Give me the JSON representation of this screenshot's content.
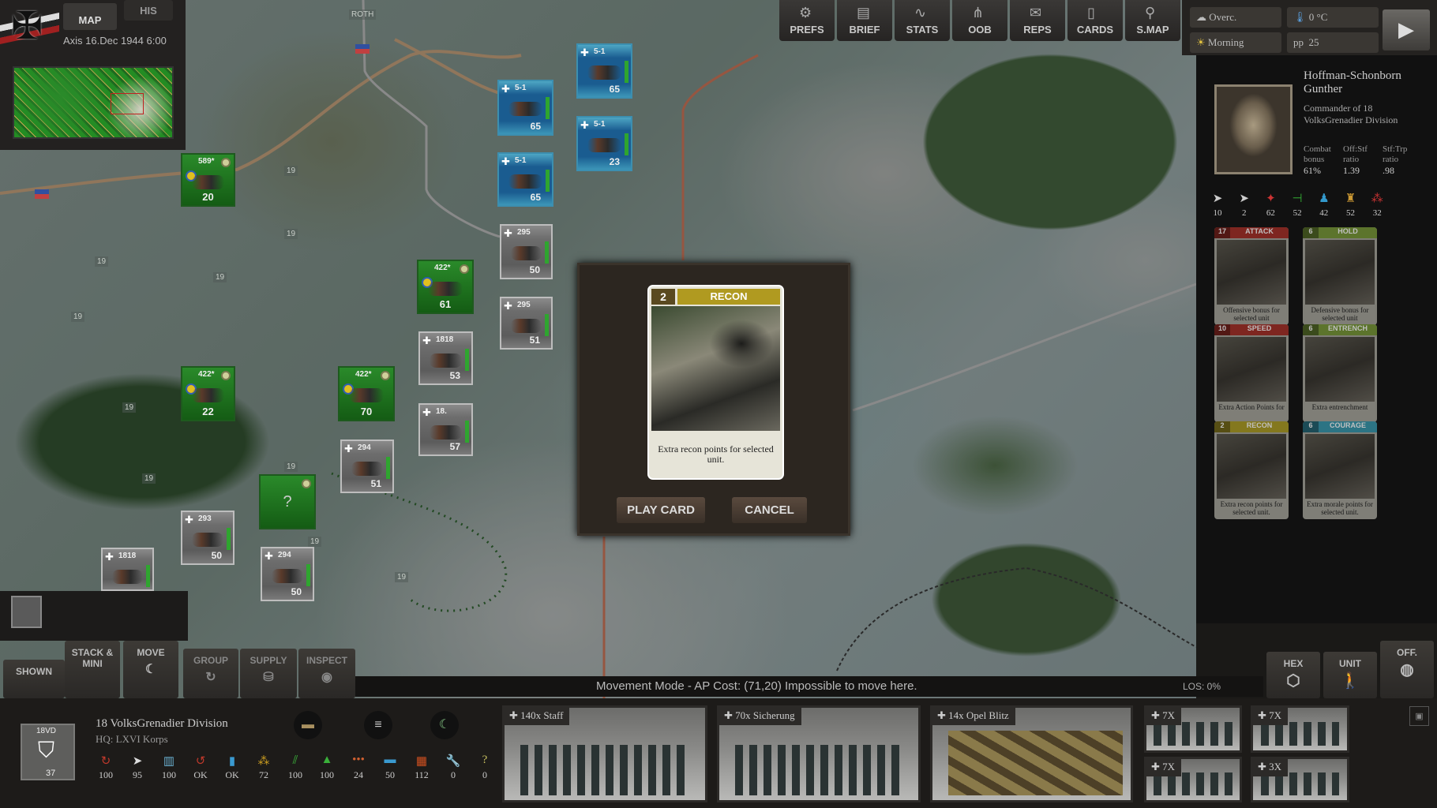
{
  "header": {
    "tabs": [
      {
        "label": "MAP"
      },
      {
        "label": "HIS"
      }
    ],
    "date": "Axis 16.Dec 1944 6:00"
  },
  "map": {
    "town_label": "ROTH",
    "hex_label": "19",
    "units": [
      {
        "side": "green",
        "label": "589*",
        "value": "20"
      },
      {
        "side": "green",
        "label": "422*",
        "value": "61"
      },
      {
        "side": "green",
        "label": "422*",
        "value": "22"
      },
      {
        "side": "green",
        "label": "422*",
        "value": "70"
      },
      {
        "side": "green",
        "label": "",
        "value": "?"
      },
      {
        "side": "blue",
        "label": "5-1",
        "value": "65"
      },
      {
        "side": "blue",
        "label": "5-1",
        "value": "65"
      },
      {
        "side": "blue",
        "label": "5-1",
        "value": "23"
      },
      {
        "side": "blue",
        "label": "5-1",
        "value": "65"
      },
      {
        "side": "gray",
        "label": "295",
        "value": "50"
      },
      {
        "side": "gray",
        "label": "295",
        "value": "51"
      },
      {
        "side": "gray",
        "label": "1818",
        "value": "53"
      },
      {
        "side": "gray",
        "label": "18.",
        "value": "57"
      },
      {
        "side": "gray",
        "label": "294",
        "value": "51"
      },
      {
        "side": "gray",
        "label": "293",
        "value": "50"
      },
      {
        "side": "gray",
        "label": "1818",
        "value": ""
      },
      {
        "side": "gray",
        "label": "294",
        "value": "50"
      }
    ]
  },
  "toolbar": [
    {
      "label": "PREFS",
      "icon": "gear-icon",
      "glyph": "⚙"
    },
    {
      "label": "BRIEF",
      "icon": "document-icon",
      "glyph": "▤"
    },
    {
      "label": "STATS",
      "icon": "chart-icon",
      "glyph": "∿"
    },
    {
      "label": "OOB",
      "icon": "hierarchy-icon",
      "glyph": "⋔"
    },
    {
      "label": "REPS",
      "icon": "report-icon",
      "glyph": "✉"
    },
    {
      "label": "CARDS",
      "icon": "cards-icon",
      "glyph": "▯"
    },
    {
      "label": "S.MAP",
      "icon": "map-pin-icon",
      "glyph": "⚲"
    }
  ],
  "weather": {
    "sky": "Overc.",
    "temperature": "0 °C",
    "time_of_day": "Morning",
    "pp_label": "pp",
    "pp": "25"
  },
  "commander": {
    "name": "Hoffman-Schonborn Gunther",
    "title": "Commander of 18 VolksGrenadier Division",
    "stats": [
      {
        "label": "Combat bonus",
        "value": "61%"
      },
      {
        "label": "Off:Stf ratio",
        "value": "1.39"
      },
      {
        "label": "Stf:Trp ratio",
        "value": ".98"
      }
    ],
    "icon_stats": [
      "10",
      "2",
      "62",
      "52",
      "42",
      "52",
      "32"
    ]
  },
  "hand": [
    {
      "cost": "17",
      "title": "ATTACK",
      "text": "Offensive bonus for selected unit",
      "color": "#a8322a"
    },
    {
      "cost": "6",
      "title": "HOLD",
      "text": "Defensive bonus for selected unit",
      "color": "#7a9a3a"
    },
    {
      "cost": "10",
      "title": "SPEED",
      "text": "Extra Action Points for",
      "color": "#a8322a"
    },
    {
      "cost": "6",
      "title": "ENTRENCH",
      "text": "Extra entrenchment",
      "color": "#7a9a3a"
    },
    {
      "cost": "2",
      "title": "RECON",
      "text": "Extra recon points for selected unit.",
      "color": "#b0a028"
    },
    {
      "cost": "6",
      "title": "COURAGE",
      "text": "Extra morale points for selected unit.",
      "color": "#3a9ab0"
    }
  ],
  "modal": {
    "card": {
      "cost": "2",
      "title": "RECON",
      "text": "Extra recon points for selected unit."
    },
    "play_label": "PLAY CARD",
    "cancel_label": "CANCEL"
  },
  "modes": [
    {
      "label": "SHOWN"
    },
    {
      "label": "STACK & MINI"
    },
    {
      "label": "MOVE"
    },
    {
      "label": "GROUP"
    },
    {
      "label": "SUPPLY"
    },
    {
      "label": "INSPECT"
    }
  ],
  "status": {
    "message": "Movement Mode - AP Cost: (71,20) Impossible to move here.",
    "los": "LOS: 0%"
  },
  "view_buttons": [
    {
      "label": "HEX"
    },
    {
      "label": "UNIT"
    },
    {
      "label": "OFF."
    }
  ],
  "selected": {
    "counter_label": "18VD",
    "counter_value": "37",
    "name": "18 VolksGrenadier Division",
    "hq": "HQ: LXVI Korps",
    "stats": [
      {
        "icon": "readiness-icon",
        "value": "100",
        "color": "#c0392b"
      },
      {
        "icon": "movement-icon",
        "value": "95",
        "color": "#ddd"
      },
      {
        "icon": "ammo-icon",
        "value": "100",
        "color": "#6ab0d0"
      },
      {
        "icon": "supply-icon",
        "value": "OK",
        "color": "#c0392b"
      },
      {
        "icon": "fuel-icon",
        "value": "OK",
        "color": "#3a9ad0"
      },
      {
        "icon": "pile-icon",
        "value": "72",
        "color": "#d0a020"
      },
      {
        "icon": "grass-icon",
        "value": "100",
        "color": "#3ab03a"
      },
      {
        "icon": "troops-icon",
        "value": "100",
        "color": "#3ab03a"
      },
      {
        "icon": "dots-icon",
        "value": "24",
        "color": "#d06030"
      },
      {
        "icon": "bar-icon",
        "value": "50",
        "color": "#3a9ad0"
      },
      {
        "icon": "bricks-icon",
        "value": "112",
        "color": "#d05020"
      },
      {
        "icon": "wrench-icon",
        "value": "0",
        "color": "#d08020"
      },
      {
        "icon": "question-icon",
        "value": "0",
        "color": "#c8c060"
      }
    ]
  },
  "subunits": [
    {
      "label": "140x Staff"
    },
    {
      "label": "70x Sicherung"
    },
    {
      "label": "14x Opel Blitz"
    },
    {
      "label": "7X"
    },
    {
      "label": "7X"
    },
    {
      "label": "7X"
    },
    {
      "label": "3X"
    }
  ]
}
